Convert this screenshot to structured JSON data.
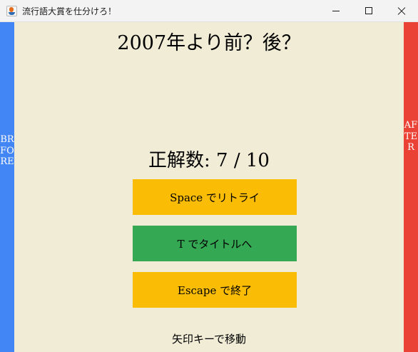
{
  "window": {
    "title": "流行語大賞を仕分けろ！",
    "app_icon": "java-cup-icon"
  },
  "side": {
    "left_label": "BRFORE",
    "right_label": "AFTER",
    "left_color": "#4285f4",
    "right_color": "#ea4335"
  },
  "main": {
    "question": "2007年より前？後？",
    "score": "正解数: 7 / 10",
    "background_color": "#f0ecd6"
  },
  "buttons": {
    "retry_label": "Space でリトライ",
    "title_label": "T でタイトルへ",
    "quit_label": "Escape で終了",
    "yellow_color": "#fbbc05",
    "green_color": "#34a853"
  },
  "hint": "矢印キーで移動"
}
